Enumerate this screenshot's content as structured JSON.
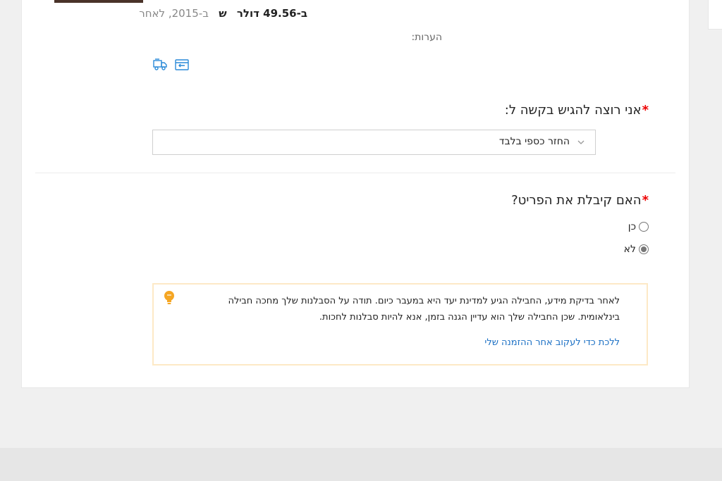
{
  "item": {
    "date_text": "ב-2015, לאחר",
    "symbol": "ש",
    "price_text": "ב-49.56 דולר",
    "notes_label": "הערות:"
  },
  "icons": {
    "shipping": "truck-return-icon",
    "refund": "card-refund-icon"
  },
  "request": {
    "label": "אני רוצה להגיש בקשה ל:",
    "selected": "החזר כספי בלבד"
  },
  "received": {
    "label": "האם קיבלת את הפריט?",
    "options": [
      {
        "label": "כן",
        "checked": false
      },
      {
        "label": "לא",
        "checked": true
      }
    ]
  },
  "notice": {
    "message": "לאחר בדיקת מידע, החבילה הגיע למדינת יעד היא במעבר כיום. תודה על הסבלנות שלך מחכה חבילה בינלאומית. שכן החבילה שלך הוא עדיין הגנה בזמן, אנא להיות סבלנות לחכות.",
    "link": "ללכת כדי לעקוב אחר ההזמנה שלי"
  },
  "colors": {
    "required": "#e00000",
    "link": "#1a6fc4",
    "notice_border": "#fde9c6",
    "bulb": "#f5a623",
    "icon": "#2a8ad8"
  }
}
